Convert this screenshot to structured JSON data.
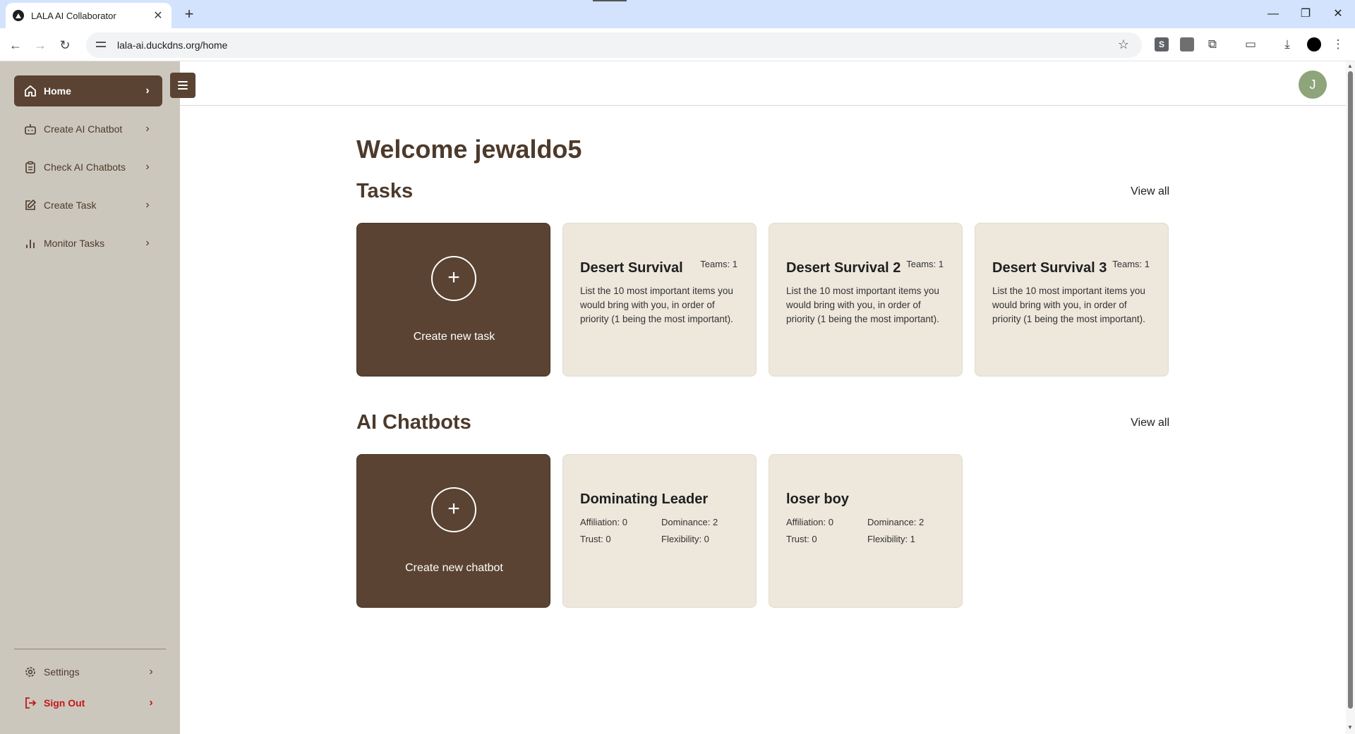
{
  "browser": {
    "tab_title": "LALA AI Collaborator",
    "url": "lala-ai.duckdns.org/home",
    "extension_s_label": "S"
  },
  "sidebar": {
    "items": [
      {
        "label": "Home",
        "icon": "home-icon"
      },
      {
        "label": "Create AI Chatbot",
        "icon": "bot-icon"
      },
      {
        "label": "Check AI Chatbots",
        "icon": "clipboard-icon"
      },
      {
        "label": "Create Task",
        "icon": "edit-icon"
      },
      {
        "label": "Monitor Tasks",
        "icon": "bar-chart-icon"
      }
    ],
    "settings_label": "Settings",
    "signout_label": "Sign Out"
  },
  "header": {
    "avatar_initial": "J"
  },
  "main": {
    "welcome": "Welcome jewaldo5",
    "tasks_title": "Tasks",
    "tasks_view_all": "View all",
    "create_task_label": "Create new task",
    "tasks": [
      {
        "title": "Desert Survival",
        "teams": "Teams: 1",
        "description": "List the 10 most important items you would bring with you, in order of priority (1 being the most important)."
      },
      {
        "title": "Desert Survival 2",
        "teams": "Teams: 1",
        "description": "List the 10 most important items you would bring with you, in order of priority (1 being the most important)."
      },
      {
        "title": "Desert Survival 3",
        "teams": "Teams: 1",
        "description": "List the 10 most important items you would bring with you, in order of priority (1 being the most important)."
      }
    ],
    "chatbots_title": "AI Chatbots",
    "chatbots_view_all": "View all",
    "create_chatbot_label": "Create new chatbot",
    "chatbots": [
      {
        "name": "Dominating Leader",
        "affiliation": "Affiliation: 0",
        "dominance": "Dominance: 2",
        "trust": "Trust: 0",
        "flexibility": "Flexibility: 0"
      },
      {
        "name": "loser boy",
        "affiliation": "Affiliation: 0",
        "dominance": "Dominance: 2",
        "trust": "Trust: 0",
        "flexibility": "Flexibility: 1"
      }
    ]
  },
  "colors": {
    "sidebar_bg": "#ccc7bd",
    "accent_brown": "#5a4332",
    "card_bg": "#ede7dc",
    "signout_red": "#c01818",
    "avatar_green": "#8ea47a"
  }
}
